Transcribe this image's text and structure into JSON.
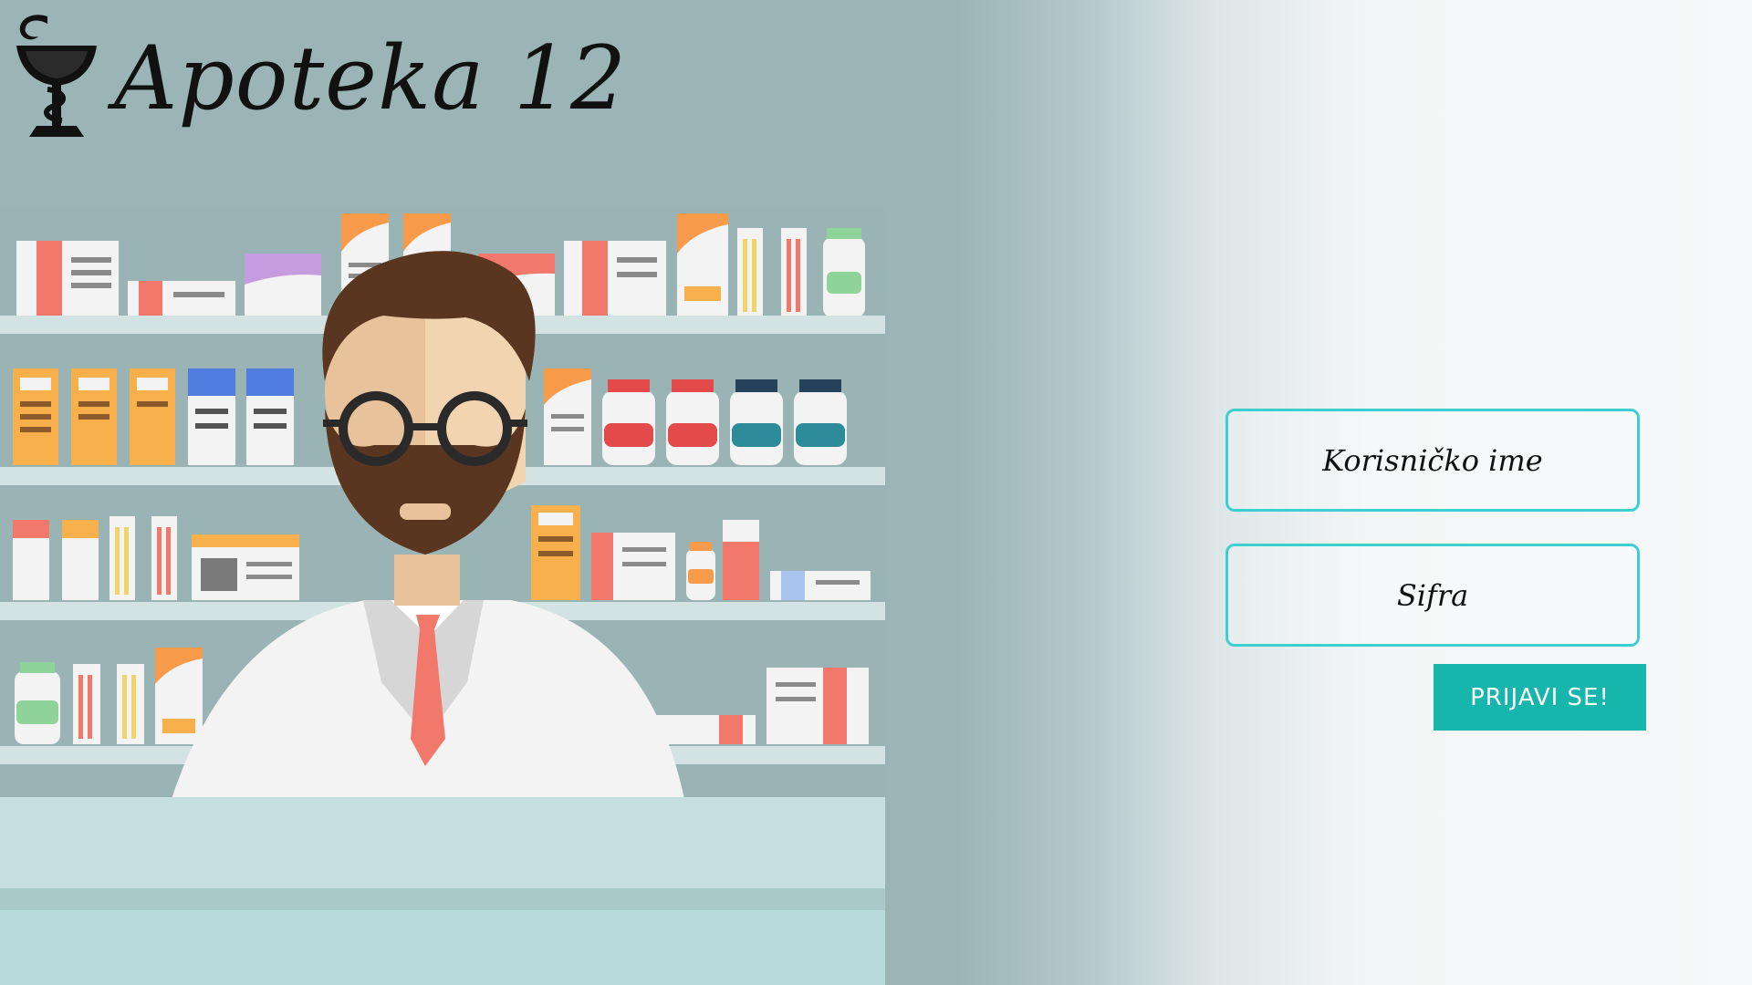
{
  "header": {
    "app_title": "Apoteka 12",
    "logo_icon": "bowl-of-hygieia-icon"
  },
  "login": {
    "username_placeholder": "Korisničko ime",
    "password_placeholder": "Sifra",
    "submit_label": "PRIJAVI SE!"
  },
  "illustration": {
    "subject": "pharmacist-illustration"
  },
  "colors": {
    "background_left": "#9bb5b6",
    "background_right": "#f7f8f9",
    "input_border": "#3ccfd0",
    "button_bg": "#17b6ac",
    "button_text": "#ffffff",
    "title_text": "#111111"
  }
}
